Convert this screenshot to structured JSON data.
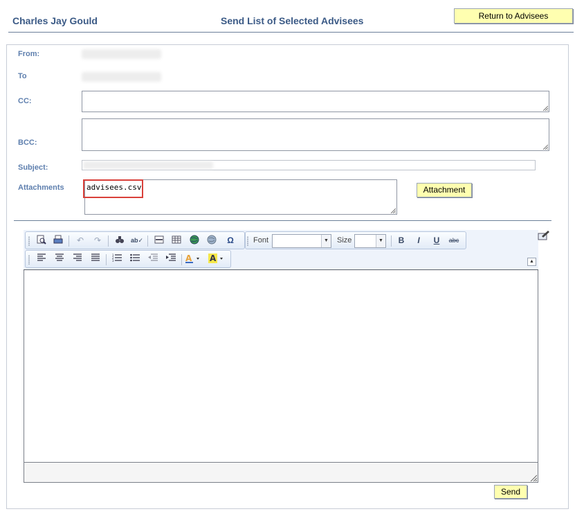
{
  "header": {
    "user_name": "Charles Jay Gould",
    "page_title": "Send List of Selected Advisees",
    "return_label": "Return to Advisees"
  },
  "form": {
    "from_label": "From:",
    "to_label": "To",
    "cc_label": "CC:",
    "bcc_label": "BCC:",
    "subject_label": "Subject:",
    "attachments_label": "Attachments",
    "attachment_file": "advisees.csv",
    "attachment_button": "Attachment"
  },
  "editor": {
    "font_label": "Font",
    "size_label": "Size",
    "bold": "B",
    "italic": "I",
    "underline": "U",
    "strike": "abc"
  },
  "actions": {
    "send_label": "Send"
  },
  "colors": {
    "header_text": "#3b5a86",
    "label_text": "#5e7fae",
    "button_bg": "#ffffb0",
    "highlight": "#d9403a"
  }
}
